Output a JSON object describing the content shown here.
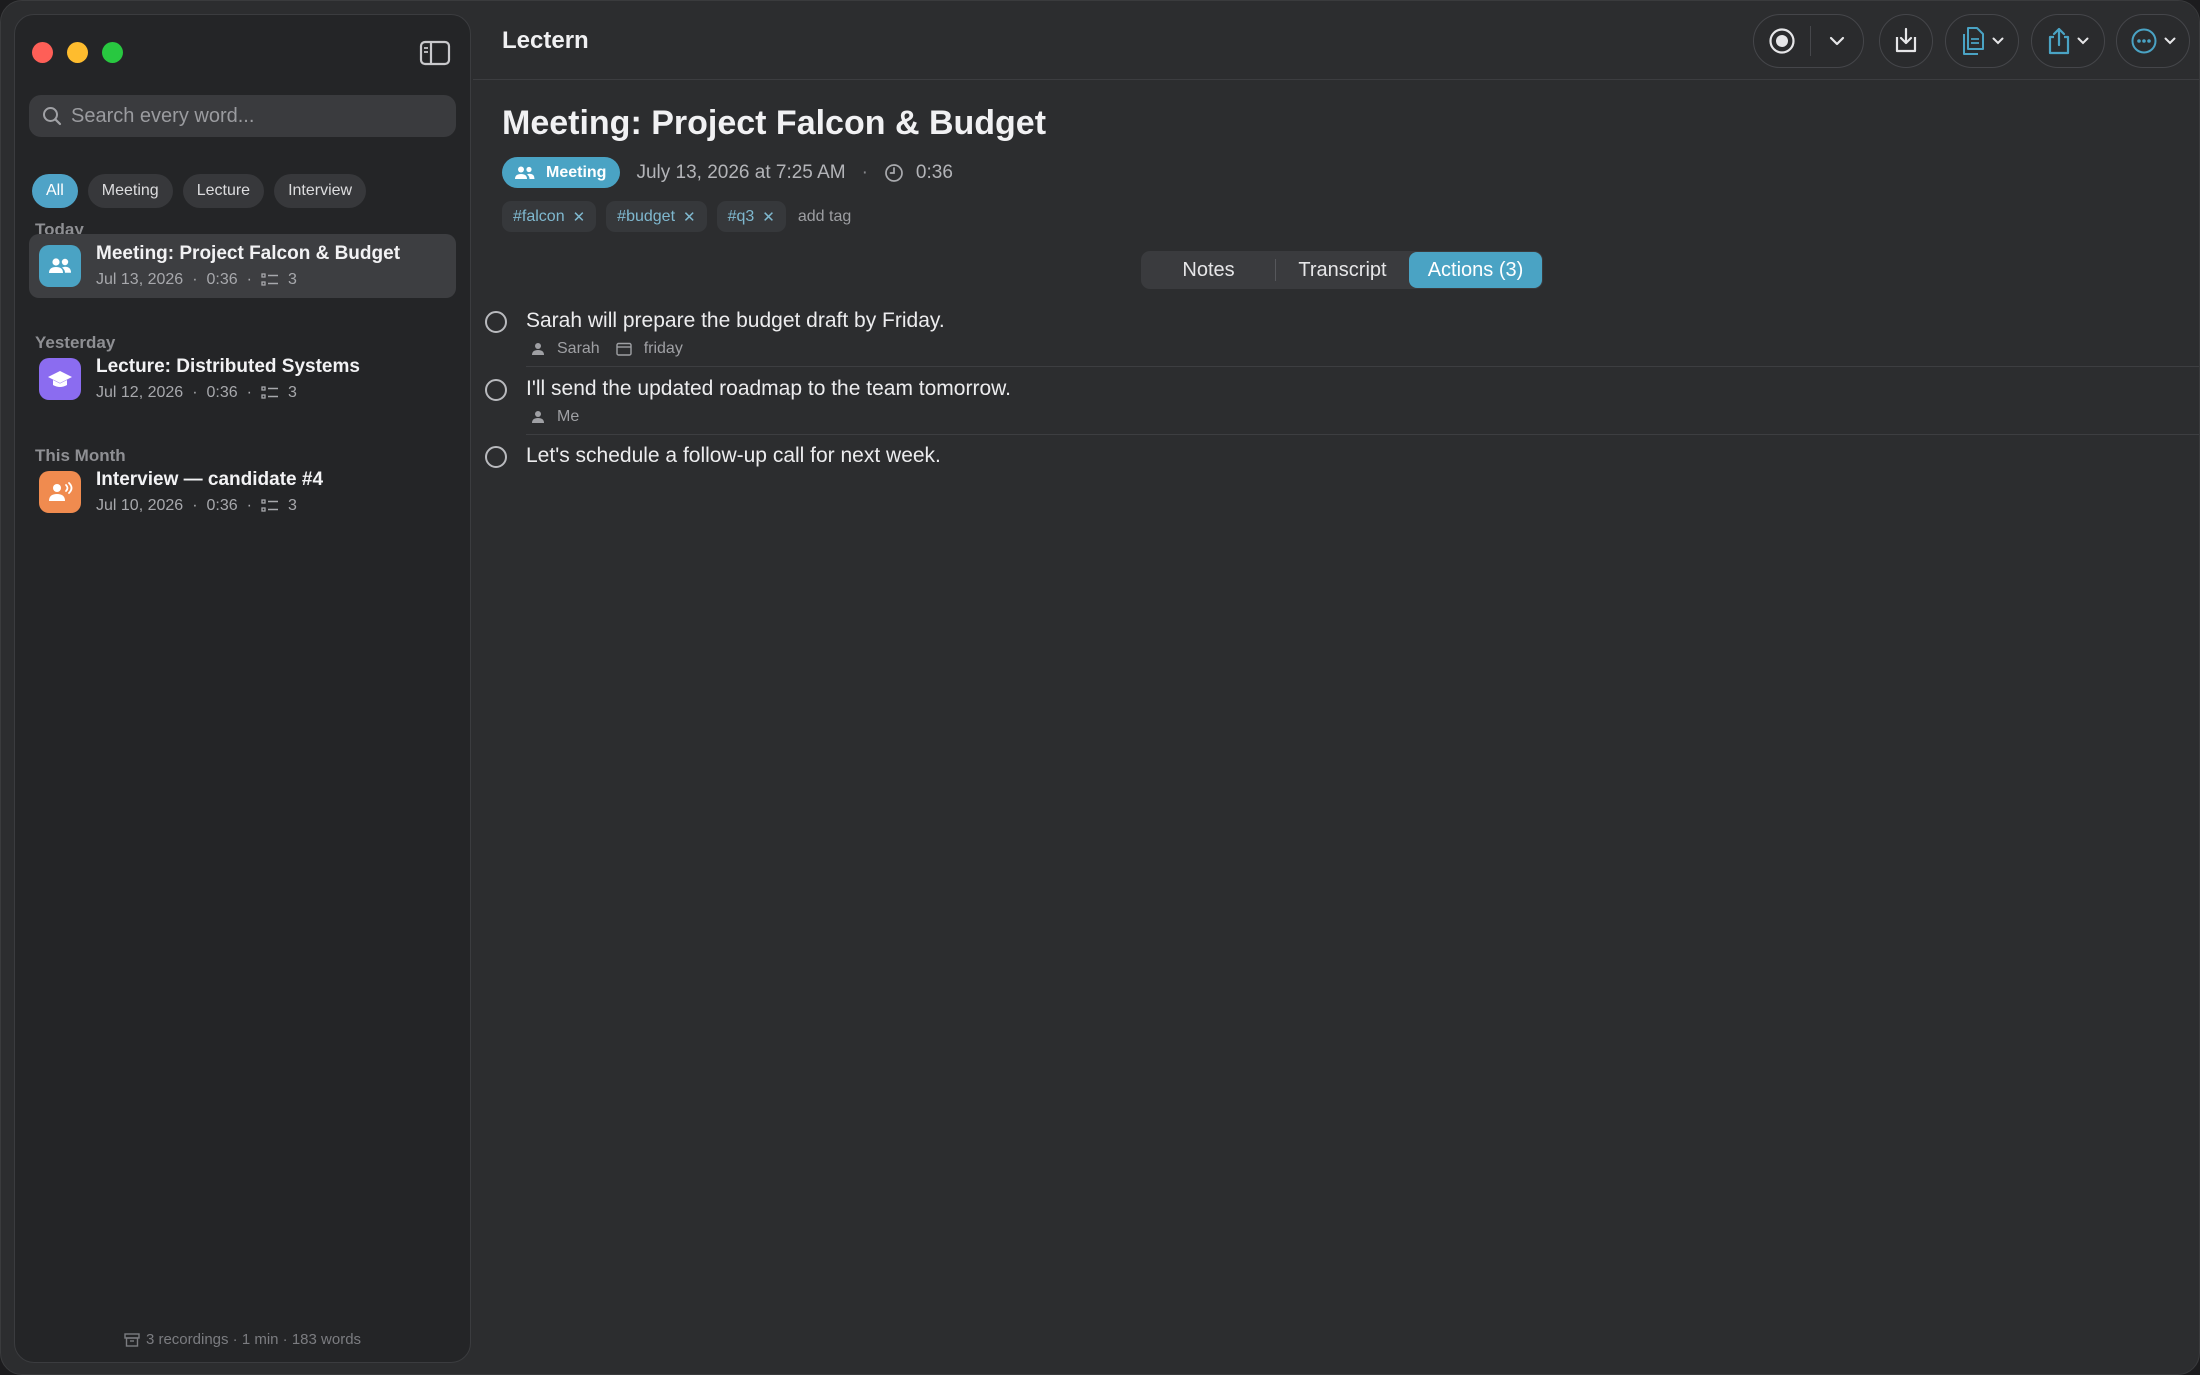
{
  "app": {
    "title": "Lectern"
  },
  "sidebar": {
    "search_placeholder": "Search every word...",
    "filters": [
      "All",
      "Meeting",
      "Lecture",
      "Interview"
    ],
    "active_filter": "All",
    "groups": [
      {
        "label": "Today",
        "items": [
          {
            "title": "Meeting: Project Falcon & Budget",
            "date": "Jul 13, 2026",
            "duration": "0:36",
            "action_count": "3",
            "type_icon": "people-icon",
            "selected": true
          }
        ]
      },
      {
        "label": "Yesterday",
        "items": [
          {
            "title": "Lecture: Distributed Systems",
            "date": "Jul 12, 2026",
            "duration": "0:36",
            "action_count": "3",
            "type_icon": "graduation-cap-icon",
            "selected": false
          }
        ]
      },
      {
        "label": "This Month",
        "items": [
          {
            "title": "Interview — candidate #4",
            "date": "Jul 10, 2026",
            "duration": "0:36",
            "action_count": "3",
            "type_icon": "speaking-person-icon",
            "selected": false
          }
        ]
      }
    ],
    "footer": "3 recordings · 1 min · 183 words"
  },
  "toolbar": {
    "buttons": [
      "record-icon",
      "chevron-down-icon",
      "download-icon",
      "copy-icon",
      "share-icon",
      "more-icon"
    ]
  },
  "note": {
    "title": "Meeting: Project Falcon & Budget",
    "type_label": "Meeting",
    "date": "July 13, 2026 at 7:25 AM",
    "separator": "·",
    "duration": "0:36",
    "tags": [
      "#falcon",
      "#budget",
      "#q3"
    ],
    "tag_remove_glyph": "✕",
    "add_tag": "add tag"
  },
  "tabs": [
    "Notes",
    "Transcript",
    "Actions (3)"
  ],
  "active_tab": "Actions (3)",
  "actions": [
    {
      "text": "Sarah will prepare the budget draft by Friday.",
      "assignee": "Sarah",
      "due": "friday"
    },
    {
      "text": "I'll send the updated roadmap to the team tomorrow.",
      "assignee": "Me",
      "due": ""
    },
    {
      "text": "Let's schedule a follow-up call for next week.",
      "assignee": "",
      "due": ""
    }
  ],
  "colors": {
    "accent": "#4aa3c4",
    "lecture": "#8b6cf0",
    "interview": "#f08b4f"
  }
}
